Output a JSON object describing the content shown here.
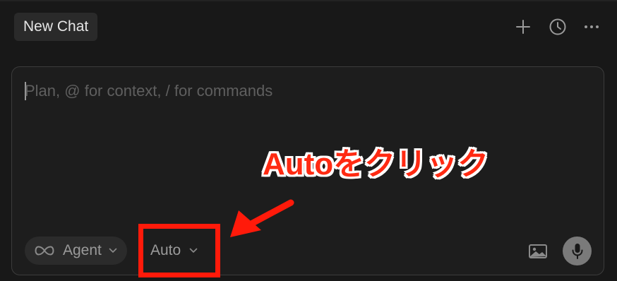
{
  "header": {
    "tab_label": "New Chat",
    "actions": [
      {
        "name": "new-chat",
        "icon": "plus-icon"
      },
      {
        "name": "history",
        "icon": "clock-icon"
      },
      {
        "name": "more",
        "icon": "ellipsis-icon"
      }
    ]
  },
  "composer": {
    "placeholder": "Plan, @ for context, / for commands",
    "value": "",
    "mode": {
      "icon": "infinity-icon",
      "label": "Agent"
    },
    "model": {
      "label": "Auto"
    },
    "image_icon": "image-icon",
    "mic_icon": "microphone-icon"
  },
  "annotation": {
    "callout_text": "Autoをクリック",
    "color": "#ff2a12"
  }
}
